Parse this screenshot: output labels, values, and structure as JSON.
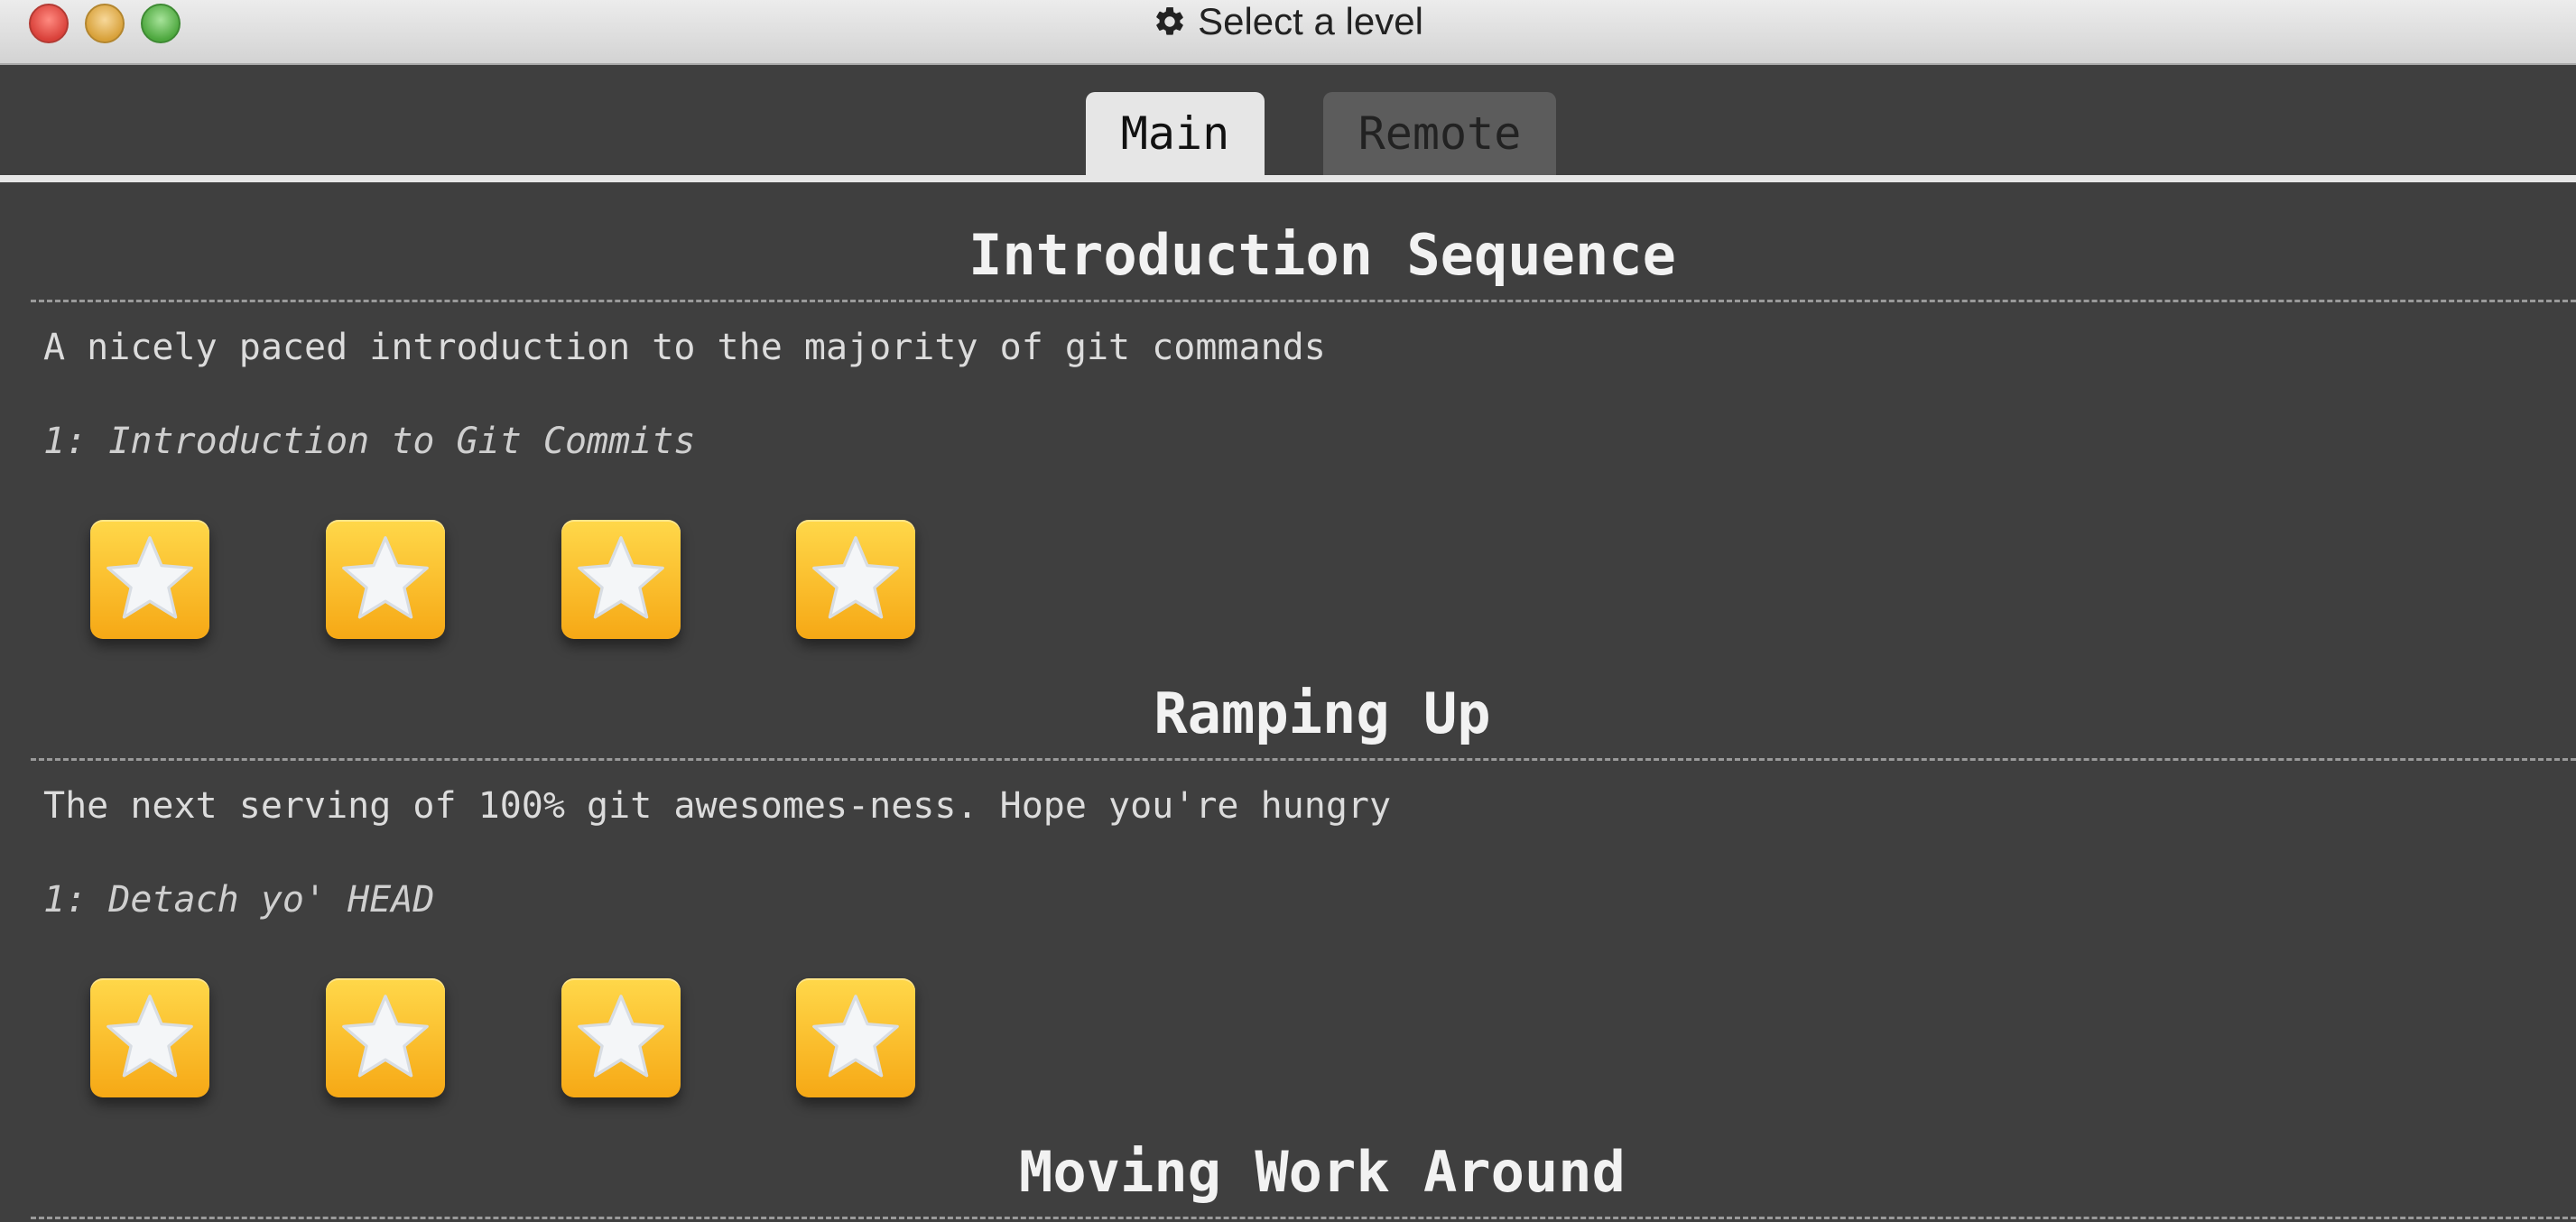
{
  "window": {
    "title": "Select a level",
    "title_icon": "gear-icon",
    "controls": [
      "close",
      "minimize",
      "maximize"
    ]
  },
  "tabs": [
    {
      "label": "Main",
      "active": true
    },
    {
      "label": "Remote",
      "active": false
    }
  ],
  "sections": [
    {
      "title": "Introduction Sequence",
      "description": "A nicely paced introduction to the majority of git commands",
      "level_name": "1: Introduction to Git Commits",
      "levels": [
        1,
        2,
        3,
        4
      ]
    },
    {
      "title": "Ramping Up",
      "description": "The next serving of 100% git awesomes-ness. Hope you're hungry",
      "level_name": "1: Detach yo' HEAD",
      "levels": [
        1,
        2,
        3,
        4
      ]
    },
    {
      "title": "Moving Work Around"
    }
  ],
  "colors": {
    "background": "#404040",
    "star_button_top": "#ffd84a",
    "star_button_bottom": "#f6a815",
    "star": "#f4f6f8"
  }
}
